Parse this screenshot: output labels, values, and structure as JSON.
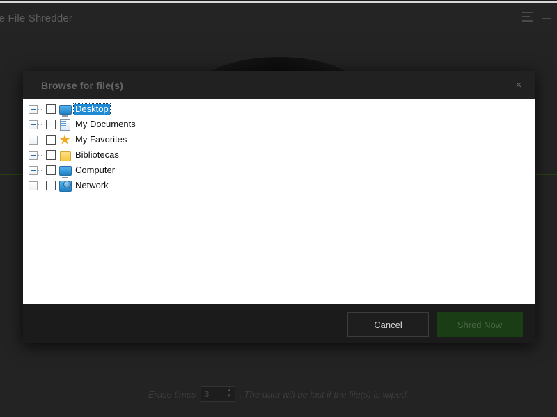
{
  "window": {
    "title": "ee File Shredder",
    "menu_icon": "list-menu-icon",
    "minimize_icon": "minimize-icon"
  },
  "background": {
    "faint_text": "",
    "erase": {
      "label": "Erase times",
      "value": "3",
      "up_arrow": "▴",
      "down_arrow": "▾",
      "note": ", The data will be lost if the file(s) is wiped."
    }
  },
  "dialog": {
    "title": "Browse for file(s)",
    "close_label": "×",
    "tree": [
      {
        "label": "Desktop",
        "icon": "monitor-icon",
        "selected": true,
        "checked": false,
        "expandable": true
      },
      {
        "label": "My Documents",
        "icon": "document-icon",
        "selected": false,
        "checked": false,
        "expandable": true
      },
      {
        "label": "My Favorites",
        "icon": "star-icon",
        "selected": false,
        "checked": false,
        "expandable": true
      },
      {
        "label": "Bibliotecas",
        "icon": "folder-icon",
        "selected": false,
        "checked": false,
        "expandable": true
      },
      {
        "label": "Computer",
        "icon": "monitor-icon",
        "selected": false,
        "checked": false,
        "expandable": true
      },
      {
        "label": "Network",
        "icon": "network-icon",
        "selected": false,
        "checked": false,
        "expandable": true
      }
    ],
    "buttons": {
      "cancel": "Cancel",
      "shred": "Shred Now"
    }
  },
  "colors": {
    "selection_blue": "#1e8ad6",
    "shred_green": "#1b3d16",
    "rule_green": "#2a4212",
    "window_bg": "#232323",
    "dialog_bg": "#1b1b1b"
  }
}
